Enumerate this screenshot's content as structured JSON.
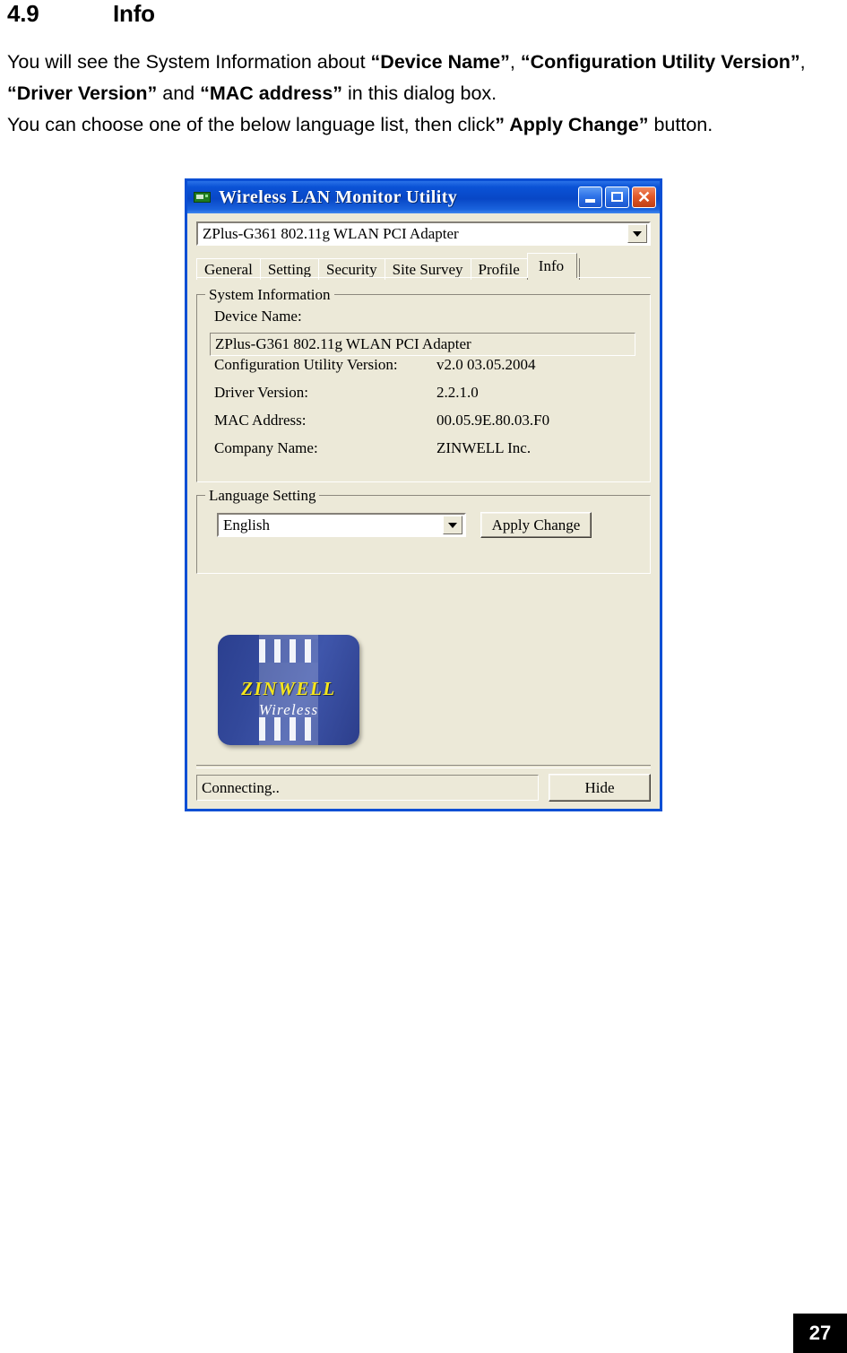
{
  "document": {
    "section_number": "4.9",
    "section_title": "Info",
    "paragraph1_part1": "You will see the System Information about ",
    "paragraph1_bold1": "“Device Name”",
    "paragraph1_part2": ", ",
    "paragraph1_bold2": "“Configuration Utility Version”",
    "paragraph1_part3": ", ",
    "paragraph1_bold3": "“Driver Version”",
    "paragraph1_part4": " and ",
    "paragraph1_bold4": "“MAC address”",
    "paragraph1_part5": " in this dialog box.",
    "paragraph2_part1": "You can choose one of the below language list, then click",
    "paragraph2_bold1": "” Apply Change”",
    "paragraph2_part2": " button.",
    "page_number": "27"
  },
  "window": {
    "title": "Wireless LAN Monitor Utility",
    "icon": "network-card-icon",
    "titlebar_color": "#0a52d6",
    "client_color": "#ece9d8",
    "buttons": {
      "minimize": "minimize-icon",
      "maximize": "maximize-icon",
      "close": "✕"
    }
  },
  "adapter_combo": {
    "value": "ZPlus-G361 802.11g WLAN PCI Adapter",
    "arrow": "chevron-down-icon"
  },
  "tabs": [
    {
      "label": "General",
      "active": false
    },
    {
      "label": "Setting",
      "active": false
    },
    {
      "label": "Security",
      "active": false
    },
    {
      "label": "Site Survey",
      "active": false
    },
    {
      "label": "Profile",
      "active": false
    },
    {
      "label": "Info",
      "active": true
    }
  ],
  "system_information": {
    "legend": "System Information",
    "device_name_label": "Device Name:",
    "device_name_value": "ZPlus-G361 802.11g WLAN PCI Adapter",
    "rows": [
      {
        "label": "Configuration Utility Version:",
        "value": "v2.0 03.05.2004"
      },
      {
        "label": "Driver Version:",
        "value": "2.2.1.0"
      },
      {
        "label": "MAC Address:",
        "value": "00.05.9E.80.03.F0"
      },
      {
        "label": "Company Name:",
        "value": "ZINWELL Inc."
      }
    ]
  },
  "language_setting": {
    "legend": "Language Setting",
    "selected": "English",
    "arrow": "chevron-down-icon",
    "apply_label": "Apply Change"
  },
  "logo": {
    "brand": "ZINWELL",
    "tagline": "Wireless",
    "brand_color": "#f5e61c",
    "background_color": "#33499b"
  },
  "statusbar": {
    "status_text": "Connecting..",
    "hide_label": "Hide"
  }
}
